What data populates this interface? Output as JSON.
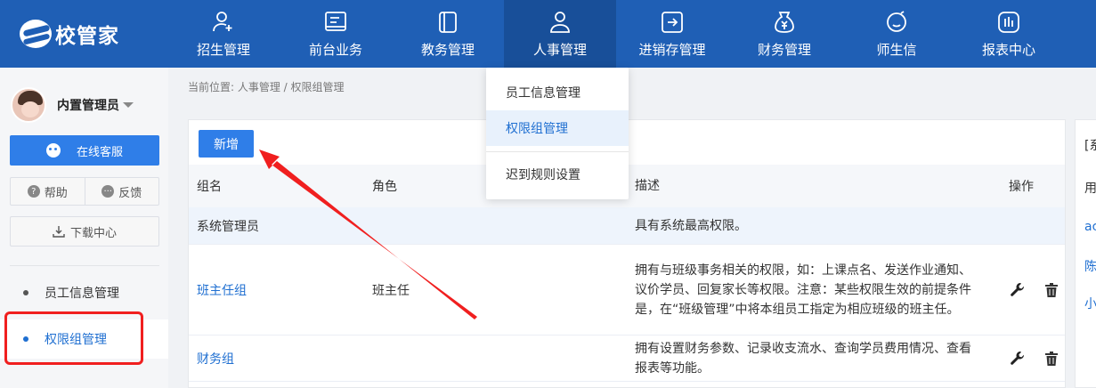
{
  "logo": {
    "text": "校管家"
  },
  "nav": [
    {
      "label": "招生管理",
      "icon": "user-add-icon"
    },
    {
      "label": "前台业务",
      "icon": "monitor-icon"
    },
    {
      "label": "教务管理",
      "icon": "book-icon"
    },
    {
      "label": "人事管理",
      "icon": "person-icon",
      "active": true
    },
    {
      "label": "进销存管理",
      "icon": "import-box-icon"
    },
    {
      "label": "财务管理",
      "icon": "money-bag-icon"
    },
    {
      "label": "师生信",
      "icon": "chat-icon"
    },
    {
      "label": "报表中心",
      "icon": "report-chart-icon"
    }
  ],
  "user": {
    "name": "内置管理员"
  },
  "sidebar": {
    "service_label": "在线客服",
    "help_label": "帮助",
    "feedback_label": "反馈",
    "download_label": "下载中心",
    "items": [
      {
        "label": "员工信息管理"
      },
      {
        "label": "权限组管理",
        "active": true
      }
    ]
  },
  "breadcrumb": "当前位置: 人事管理 / 权限组管理",
  "toolbar": {
    "add_label": "新增"
  },
  "table": {
    "headers": [
      "组名",
      "角色",
      "描述",
      "操作"
    ],
    "rows": [
      {
        "name": "系统管理员",
        "role": "",
        "desc": "具有系统最高权限。"
      },
      {
        "name": "班主任组",
        "role": "班主任",
        "desc": "拥有与班级事务相关的权限，如：上课点名、发送作业通知、议价学员、回复家长等权限。注意：某些权限生效的前提条件是，在“班级管理”中将本组员工指定为相应班级的班主任。"
      },
      {
        "name": "财务组",
        "role": "",
        "desc": "拥有设置财务参数、记录收支流水、查询学员费用情况、查看报表等功能。"
      }
    ]
  },
  "dropdown": {
    "items": [
      {
        "label": "员工信息管理"
      },
      {
        "label": "权限组管理",
        "active": true
      },
      {
        "label": "迟到规则设置"
      }
    ]
  },
  "right_panel": {
    "lines": [
      "[系",
      "用",
      "ac",
      "陈",
      "小"
    ]
  },
  "colors": {
    "nav_bg": "#1f5fb5",
    "nav_active": "#184f99",
    "primary": "#2f7ee8",
    "link": "#1f6fd1",
    "annotation": "#f01f1f"
  }
}
